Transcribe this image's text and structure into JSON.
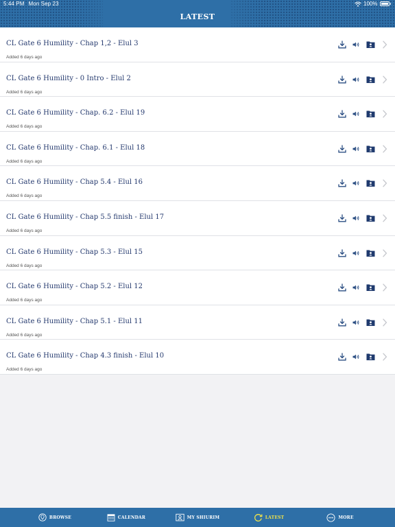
{
  "status_bar": {
    "time": "5:44 PM",
    "date": "Mon Sep 23",
    "battery": "100%"
  },
  "header": {
    "title": "LATEST"
  },
  "items": [
    {
      "title": "CL Gate 6 Humility - Chap 1,2 - Elul 3",
      "subtitle": "Added 6 days ago"
    },
    {
      "title": "CL Gate 6 Humility - 0 Intro - Elul 2",
      "subtitle": "Added 6 days ago"
    },
    {
      "title": "CL Gate 6 Humility - Chap. 6.2 - Elul 19",
      "subtitle": "Added 6 days ago"
    },
    {
      "title": "CL Gate 6 Humility - Chap. 6.1 - Elul 18",
      "subtitle": "Added 6 days ago"
    },
    {
      "title": "CL Gate 6 Humility - Chap 5.4 - Elul 16",
      "subtitle": "Added 6 days ago"
    },
    {
      "title": "CL Gate 6 Humility - Chap 5.5 finish - Elul 17",
      "subtitle": "Added 6 days ago"
    },
    {
      "title": "CL Gate 6 Humility - Chap 5.3 - Elul 15",
      "subtitle": "Added 6 days ago"
    },
    {
      "title": "CL Gate 6 Humility - Chap 5.2 - Elul 12",
      "subtitle": "Added 6 days ago"
    },
    {
      "title": "CL Gate 6 Humility - Chap 5.1 - Elul 11",
      "subtitle": "Added 6 days ago"
    },
    {
      "title": "CL Gate 6 Humility - Chap 4.3 finish - Elul 10",
      "subtitle": "Added 6 days ago"
    }
  ],
  "row_icons": [
    "download-icon",
    "speaker-icon",
    "folder-user-icon",
    "chevron-right-icon"
  ],
  "tabs": [
    {
      "label": "BROWSE",
      "icon": "pin-icon",
      "active": false
    },
    {
      "label": "CALENDAR",
      "icon": "calendar-icon",
      "active": false
    },
    {
      "label": "MY SHIURIM",
      "icon": "profile-card-icon",
      "active": false
    },
    {
      "label": "LATEST",
      "icon": "refresh-icon",
      "active": true
    },
    {
      "label": "MORE",
      "icon": "more-icon",
      "active": false
    }
  ],
  "colors": {
    "brand": "#2e6fa7",
    "title_text": "#23386d",
    "active_tab": "#f0e34a",
    "background": "#f2f2f4"
  }
}
